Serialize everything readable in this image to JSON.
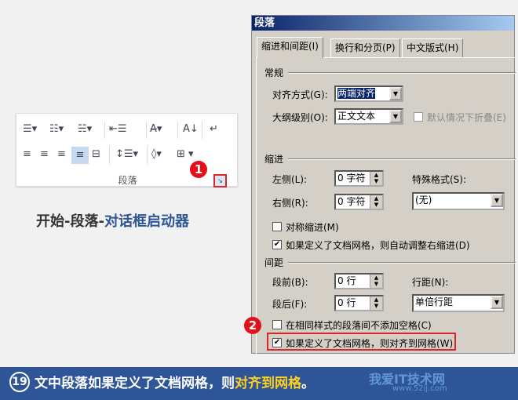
{
  "ribbon": {
    "group_label": "段落",
    "badge": "1"
  },
  "caption": {
    "part1": "开始-段落-",
    "part2": "对话框启动器"
  },
  "dialog": {
    "title": "段落",
    "tabs": [
      "缩进和间距(I)",
      "换行和分页(P)",
      "中文版式(H)"
    ],
    "general": {
      "heading": "常规",
      "alignment_label": "对齐方式(G):",
      "alignment_value": "两端对齐",
      "outline_label": "大纲级别(O):",
      "outline_value": "正文文本",
      "collapse_label": "默认情况下折叠(E)"
    },
    "indent": {
      "heading": "缩进",
      "left_label": "左侧(L):",
      "left_value": "0 字符",
      "right_label": "右侧(R):",
      "right_value": "0 字符",
      "special_label": "特殊格式(S):",
      "special_value": "(无)",
      "mirror_label": "对称缩进(M)",
      "mirror_checked": false,
      "auto_right_label": "如果定义了文档网格，则自动调整右缩进(D)",
      "auto_right_checked": true
    },
    "spacing": {
      "heading": "间距",
      "before_label": "段前(B):",
      "before_value": "0 行",
      "after_label": "段后(F):",
      "after_value": "0 行",
      "line_label": "行距(N):",
      "line_value": "单倍行距",
      "no_space_label": "在相同样式的段落间不添加空格(C)",
      "no_space_checked": false,
      "snap_label": "如果定义了文档网格，则对齐到网格(W)",
      "snap_checked": true
    },
    "badge": "2"
  },
  "banner": {
    "number": "19",
    "text": "文中段落如果定义了文档网格，则",
    "highlight": "对齐到网格",
    "end": "。"
  },
  "watermark": {
    "text": "我爱IT技术网",
    "url": "www.52ij.com"
  }
}
